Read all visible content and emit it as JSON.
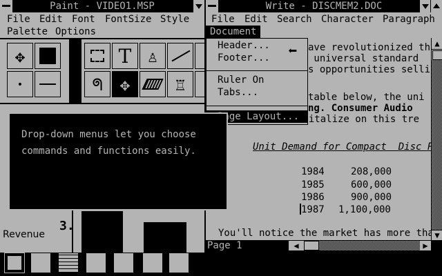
{
  "paint": {
    "title": "Paint - VIDEO1.MSP",
    "menu": [
      "File",
      "Edit",
      "Font",
      "FontSize",
      "Style",
      "Palette",
      "Options"
    ],
    "tools": [
      {
        "name": "move-icon",
        "glyph": "✥"
      },
      {
        "name": "color-swatch-icon",
        "glyph": ""
      },
      {
        "name": "selection-icon",
        "glyph": "⛶"
      },
      {
        "name": "text-tool-icon",
        "glyph": "T"
      },
      {
        "name": "paint-bucket-icon",
        "glyph": "♙"
      },
      {
        "name": "line-tool-icon",
        "glyph": "/"
      },
      {
        "name": "dot-icon",
        "glyph": "•"
      },
      {
        "name": "line-width-icon",
        "glyph": "—"
      },
      {
        "name": "lasso-icon",
        "glyph": "ᖗ"
      },
      {
        "name": "move-selected-icon",
        "glyph": "✥"
      },
      {
        "name": "eraser-icon",
        "glyph": "◫"
      },
      {
        "name": "brush-icon",
        "glyph": "♖"
      }
    ],
    "tooltip": "Drop-down menus let you choose\ncommands and functions easily.",
    "canvas_text": "Revenue",
    "canvas_number": "3."
  },
  "write": {
    "title": "Write - DISCMEM2.DOC",
    "menu": [
      "File",
      "Edit",
      "Search",
      "Character",
      "Paragraph",
      "Document"
    ],
    "active_menu": "Document",
    "dropdown": [
      "Header...",
      "Footer...",
      "Ruler On",
      "Tabs...",
      "Page Layout..."
    ],
    "lines": [
      "ave revolutionized th",
      " universal standard",
      "s opportunities sellin",
      "",
      "table below, the uni",
      "ng. Consumer Audio",
      "ssist way to capitalize on this tre"
    ],
    "table_title": "Unit Demand for Compact  Disc Pl",
    "table": [
      {
        "year": "1984",
        "value": "208,000"
      },
      {
        "year": "1985",
        "value": "600,000"
      },
      {
        "year": "1986",
        "value": "900,000"
      },
      {
        "year": "1987",
        "value": "1,100,000"
      }
    ],
    "bottom_line": "You'll notice the market has more tha",
    "page_label": "Page 1"
  },
  "taskbar": [
    "msdos-exec-icon",
    "calendar-icon",
    "spreadsheet-icon",
    "cardfile-icon",
    "clock-icon",
    "notepad-icon",
    "terminal-icon"
  ]
}
